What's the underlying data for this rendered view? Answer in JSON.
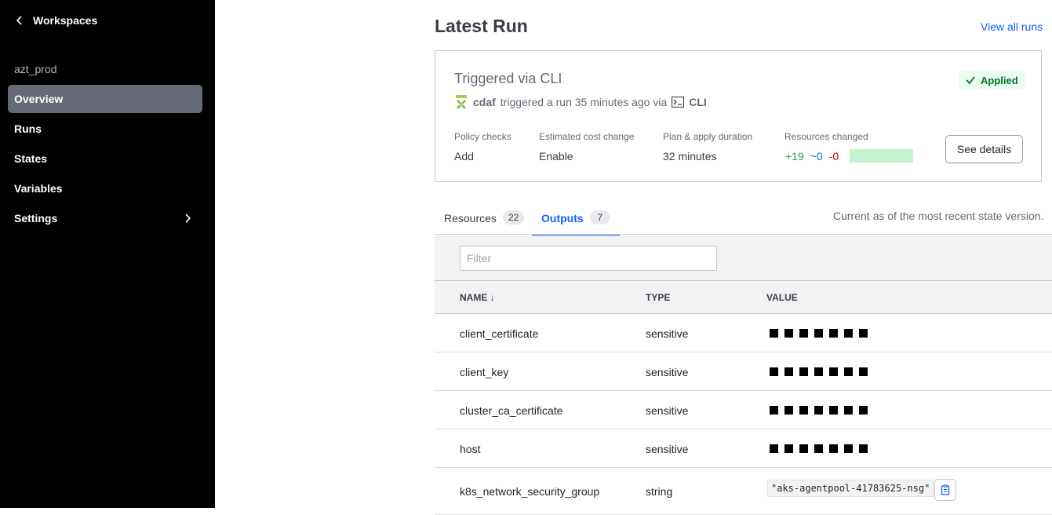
{
  "sidebar": {
    "back_label": "Workspaces",
    "workspace_name": "azt_prod",
    "items": [
      {
        "label": "Overview",
        "active": true
      },
      {
        "label": "Runs"
      },
      {
        "label": "States"
      },
      {
        "label": "Variables"
      },
      {
        "label": "Settings",
        "has_submenu": true
      }
    ]
  },
  "header": {
    "title": "Latest Run",
    "view_all": "View all runs"
  },
  "run": {
    "title": "Triggered via CLI",
    "status": "Applied",
    "user": "cdaf",
    "triggered_text": "triggered a run 35 minutes ago via",
    "via": "CLI",
    "policy_label": "Policy checks",
    "policy_value": "Add",
    "cost_label": "Estimated cost change",
    "cost_value": "Enable",
    "duration_label": "Plan & apply duration",
    "duration_value": "32 minutes",
    "resources_label": "Resources changed",
    "added": "+19",
    "changed": "~0",
    "destroyed": "-0",
    "see_details": "See details"
  },
  "tabs": [
    {
      "label": "Resources",
      "count": "22"
    },
    {
      "label": "Outputs",
      "count": "7",
      "active": true
    }
  ],
  "state_note": "Current as of the most recent state version.",
  "filter": {
    "placeholder": "Filter"
  },
  "table": {
    "headers": {
      "name": "NAME ↓",
      "type": "TYPE",
      "value": "VALUE"
    },
    "rows": [
      {
        "name": "client_certificate",
        "type": "sensitive"
      },
      {
        "name": "client_key",
        "type": "sensitive"
      },
      {
        "name": "cluster_ca_certificate",
        "type": "sensitive"
      },
      {
        "name": "host",
        "type": "sensitive"
      },
      {
        "name": "k8s_network_security_group",
        "type": "string",
        "value": "\"aks-agentpool-41783625-nsg\""
      }
    ]
  },
  "colors": {
    "sidebar_bg": "#000000",
    "active_nav": "#656a76",
    "link": "#1060ff",
    "applied": "#00781e",
    "added": "#2ea043",
    "destroyed": "#c00005"
  }
}
